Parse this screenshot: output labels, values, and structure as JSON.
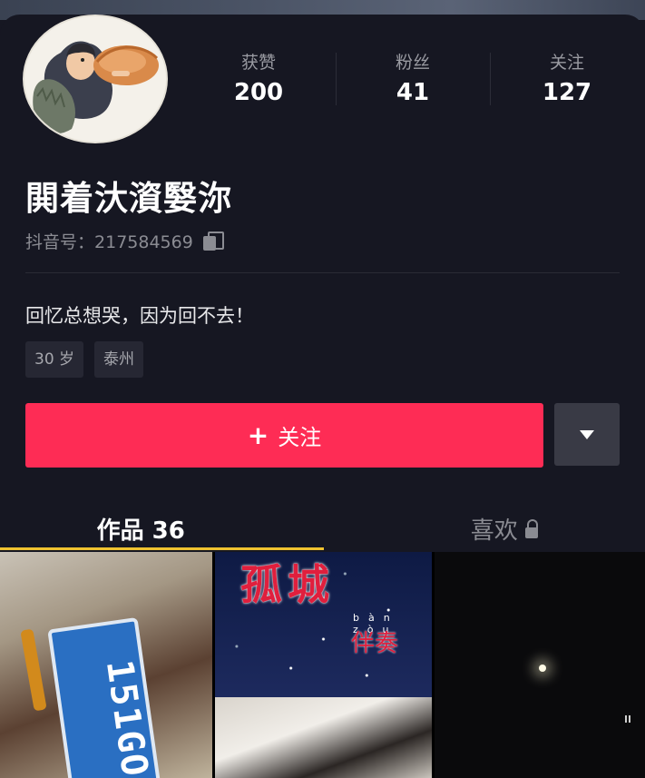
{
  "profile": {
    "nickname": "閧着汏澬嫛沵",
    "account_label": "抖音号：",
    "account_id": "217584569",
    "bio": "回忆总想哭，因为回不去！",
    "tags": [
      "30 岁",
      "泰州"
    ]
  },
  "stats": [
    {
      "label": "获赞",
      "value": "200"
    },
    {
      "label": "粉丝",
      "value": "41"
    },
    {
      "label": "关注",
      "value": "127"
    }
  ],
  "actions": {
    "follow_label": "关注",
    "follow_plus": "+"
  },
  "tabs": {
    "works_label": "作品 36",
    "likes_label": "喜欢"
  },
  "videos": {
    "plate_text": "151GO",
    "song_title": "孤城",
    "song_sub": "伴奏",
    "song_pinyin": "bàn zòu"
  },
  "colors": {
    "background": "#161722",
    "follow_button": "#fe2c55",
    "tab_indicator": "#f0c330",
    "more_button": "#393a45"
  }
}
